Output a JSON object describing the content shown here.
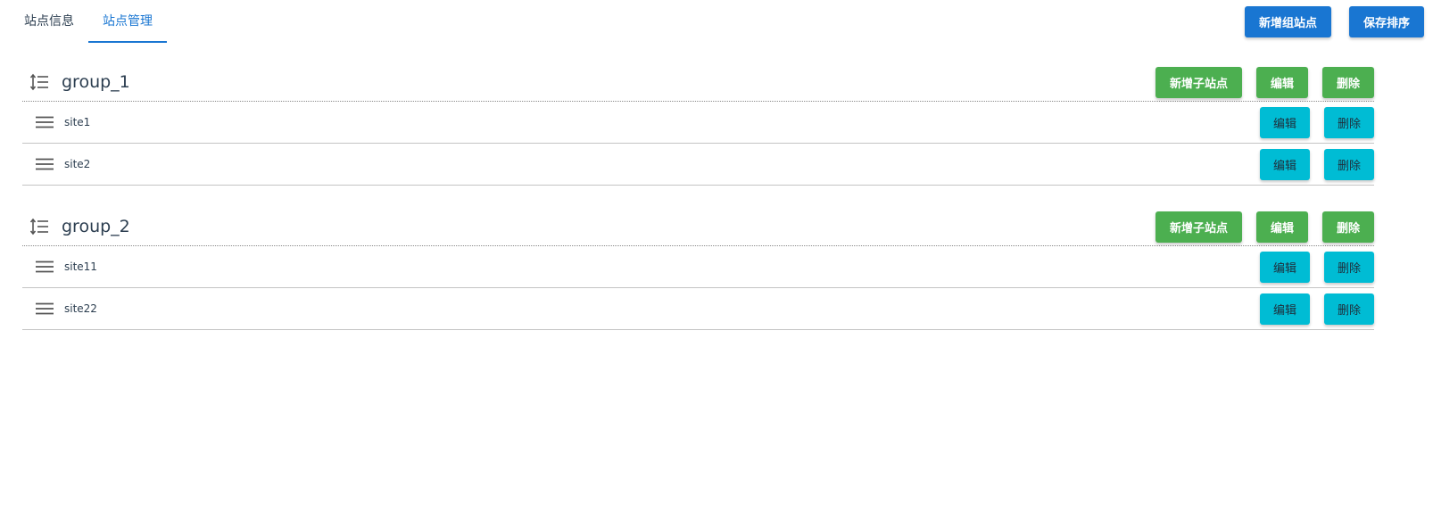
{
  "tabs": [
    {
      "label": "站点信息",
      "active": false
    },
    {
      "label": "站点管理",
      "active": true
    }
  ],
  "top_actions": {
    "add_group_label": "新增组站点",
    "save_order_label": "保存排序"
  },
  "groups": [
    {
      "title": "group_1",
      "add_child_label": "新增子站点",
      "edit_label": "编辑",
      "delete_label": "删除",
      "sites": [
        {
          "name": "site1",
          "edit_label": "编辑",
          "delete_label": "删除"
        },
        {
          "name": "site2",
          "edit_label": "编辑",
          "delete_label": "删除"
        }
      ]
    },
    {
      "title": "group_2",
      "add_child_label": "新增子站点",
      "edit_label": "编辑",
      "delete_label": "删除",
      "sites": [
        {
          "name": "site11",
          "edit_label": "编辑",
          "delete_label": "删除"
        },
        {
          "name": "site22",
          "edit_label": "编辑",
          "delete_label": "删除"
        }
      ]
    }
  ],
  "icons": {
    "group_handle": "sort-list-icon",
    "site_handle": "drag-handle-icon"
  },
  "colors": {
    "primary": "#1976d2",
    "success": "#4caf50",
    "info": "#00bcd4",
    "text": "#2c3e50"
  }
}
